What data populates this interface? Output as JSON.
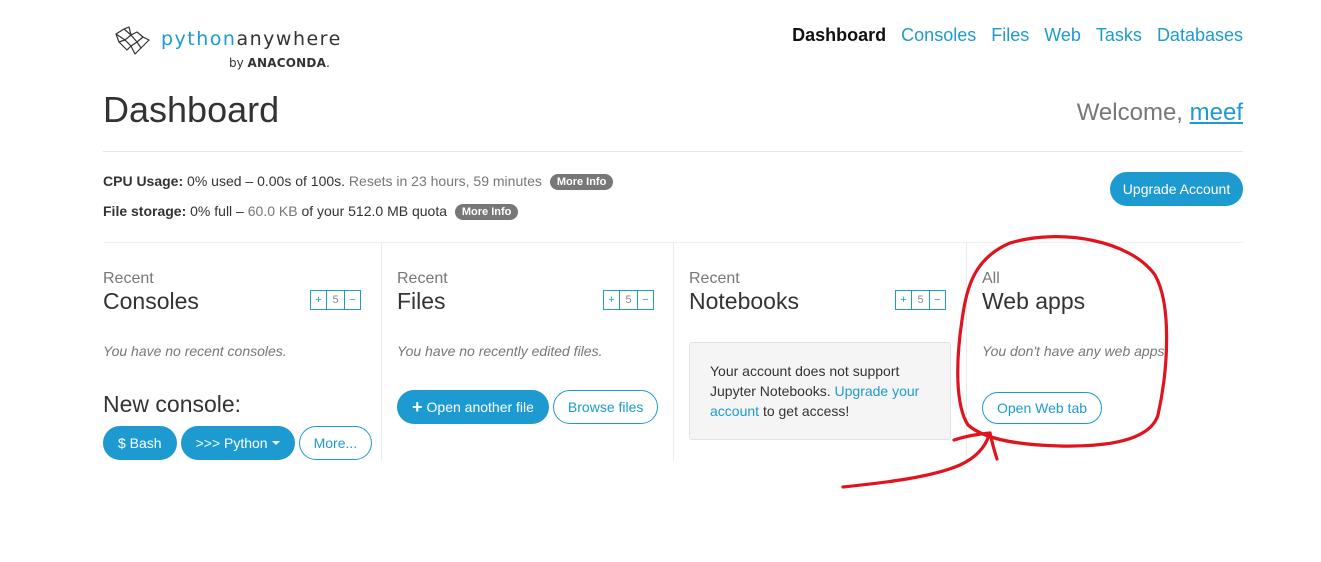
{
  "logo": {
    "word_python": "python",
    "word_anywhere": "anywhere",
    "by": "by",
    "brand": "ANACONDA",
    "brand_suffix": "."
  },
  "nav": [
    {
      "label": "Dashboard",
      "active": true
    },
    {
      "label": "Consoles"
    },
    {
      "label": "Files"
    },
    {
      "label": "Web"
    },
    {
      "label": "Tasks"
    },
    {
      "label": "Databases"
    }
  ],
  "page_title": "Dashboard",
  "welcome": {
    "prefix": "Welcome,",
    "username": "meef"
  },
  "usage": {
    "cpu_label": "CPU Usage:",
    "cpu_text": "0% used – 0.00s of 100s.",
    "cpu_reset": "Resets in 23 hours, 59 minutes",
    "storage_label": "File storage:",
    "storage_pct": "0% full –",
    "storage_used": "60.0 KB",
    "storage_rest": "of your 512.0 MB quota",
    "more_info": "More Info"
  },
  "upgrade_button": "Upgrade Account",
  "consoles": {
    "small": "Recent",
    "big": "Consoles",
    "count": "5",
    "empty": "You have no recent consoles.",
    "new_console": "New console:",
    "buttons": {
      "bash": "$ Bash",
      "python": ">>> Python",
      "more": "More..."
    }
  },
  "files": {
    "small": "Recent",
    "big": "Files",
    "count": "5",
    "empty": "You have no recently edited files.",
    "open_file": "Open another file",
    "browse": "Browse files"
  },
  "notebooks": {
    "small": "Recent",
    "big": "Notebooks",
    "count": "5",
    "msg_prefix": "Your account does not support Jupyter Notebooks.",
    "msg_link": "Upgrade your account",
    "msg_suffix": "to get access!"
  },
  "webapps": {
    "small": "All",
    "big": "Web apps",
    "empty": "You don't have any web apps.",
    "open_web_tab": "Open Web tab"
  },
  "stepper_symbols": {
    "plus": "+",
    "minus": "−"
  },
  "colors": {
    "accent": "#1d9bd1",
    "annotation": "#e0141e",
    "muted": "#777777"
  }
}
